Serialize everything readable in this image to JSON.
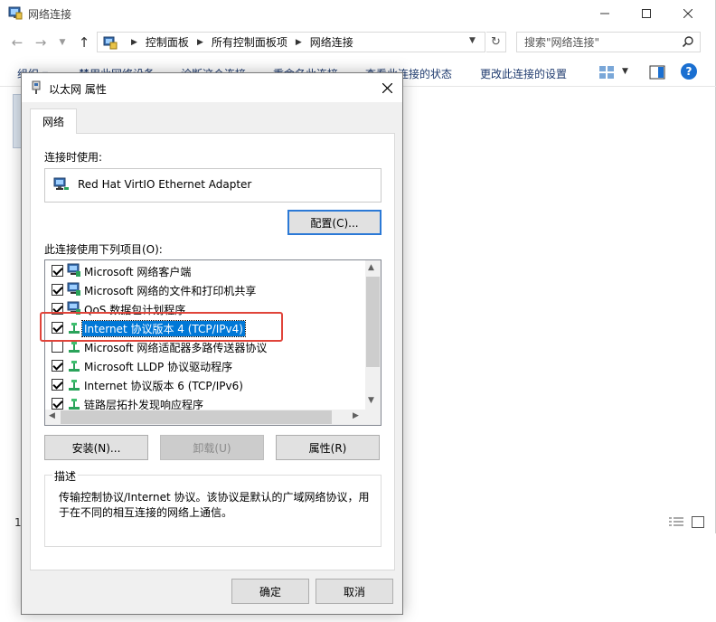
{
  "explorer": {
    "window_title": "网络连接",
    "breadcrumbs": [
      "控制面板",
      "所有控制面板项",
      "网络连接"
    ],
    "search_placeholder": "搜索\"网络连接\"",
    "commands": {
      "organize": "组织 ▾",
      "disable": "禁用此网络设备",
      "diagnose": "诊断这个连接",
      "rename": "重命名此连接",
      "status": "查看此连接的状态",
      "change": "更改此连接的设置"
    },
    "help_label": "?",
    "item_count": "1"
  },
  "dialog": {
    "title": "以太网 属性",
    "tab_label": "网络",
    "connect_using_label": "连接时使用:",
    "adapter_name": "Red Hat VirtIO Ethernet Adapter",
    "config_button": "配置(C)...",
    "items_label": "此连接使用下列项目(O):",
    "items": [
      {
        "label": "Microsoft 网络客户端",
        "checked": true,
        "icon": "network-client-icon"
      },
      {
        "label": "Microsoft 网络的文件和打印机共享",
        "checked": true,
        "icon": "network-client-icon"
      },
      {
        "label": "QoS 数据包计划程序",
        "checked": true,
        "icon": "network-client-icon"
      },
      {
        "label": "Internet 协议版本 4 (TCP/IPv4)",
        "checked": true,
        "icon": "protocol-icon",
        "selected": true
      },
      {
        "label": "Microsoft 网络适配器多路传送器协议",
        "checked": false,
        "icon": "protocol-icon"
      },
      {
        "label": "Microsoft LLDP 协议驱动程序",
        "checked": true,
        "icon": "protocol-icon"
      },
      {
        "label": "Internet 协议版本 6 (TCP/IPv6)",
        "checked": true,
        "icon": "protocol-icon"
      },
      {
        "label": "链路层拓扑发现响应程序",
        "checked": true,
        "icon": "protocol-icon"
      }
    ],
    "install_button": "安装(N)...",
    "uninstall_button": "卸载(U)",
    "properties_button": "属性(R)",
    "description_legend": "描述",
    "description_text": "传输控制协议/Internet 协议。该协议是默认的广域网络协议，用于在不同的相互连接的网络上通信。",
    "ok_button": "确定",
    "cancel_button": "取消"
  },
  "colors": {
    "selection": "#0078d7",
    "highlight_box": "#e0443a",
    "focus_border": "#2b79d6",
    "command_text": "#1e3a6e"
  }
}
